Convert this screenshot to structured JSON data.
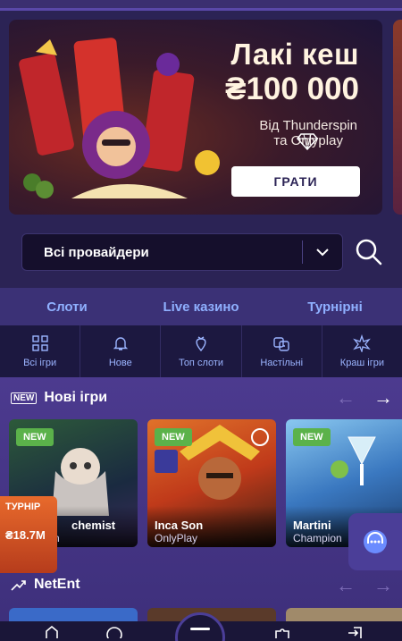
{
  "banner": {
    "title": "Лакі кеш",
    "amount": "₴100 000",
    "subtitle_line1": "Від Thunderspin",
    "subtitle_line2": "та Onlyplay",
    "play_label": "ГРАТИ"
  },
  "provider_filter": {
    "selected": "Всі провайдери"
  },
  "category_tabs": [
    {
      "label": "Слоти"
    },
    {
      "label": "Live казино"
    },
    {
      "label": "Турнірні"
    }
  ],
  "sub_tabs": [
    {
      "label": "Всі ігри",
      "icon": "grid-icon"
    },
    {
      "label": "Нове",
      "icon": "bell-icon"
    },
    {
      "label": "Топ слоти",
      "icon": "strawberry-icon"
    },
    {
      "label": "Настільні",
      "icon": "dice-icon"
    },
    {
      "label": "Краш ігри",
      "icon": "explosion-icon"
    }
  ],
  "new_games": {
    "badge": "NEW",
    "title": "Нові ігри",
    "cards": [
      {
        "tag": "NEW",
        "name": "Wild Alchemist",
        "name_visible": "chemist",
        "provider": "n"
      },
      {
        "tag": "NEW",
        "name": "Inca Son",
        "provider": "OnlyPlay"
      },
      {
        "tag": "NEW",
        "name": "Martini",
        "provider": "Champion"
      }
    ]
  },
  "tournament_widget": {
    "label": "ТУРНІР",
    "amount": "₴18.7M"
  },
  "netent": {
    "title": "NetEnt"
  },
  "colors": {
    "background": "#2b2355",
    "accent_blue": "#8fb0ff",
    "new_badge_green": "#5bb24a",
    "tournament_orange": "#e86a2c"
  }
}
